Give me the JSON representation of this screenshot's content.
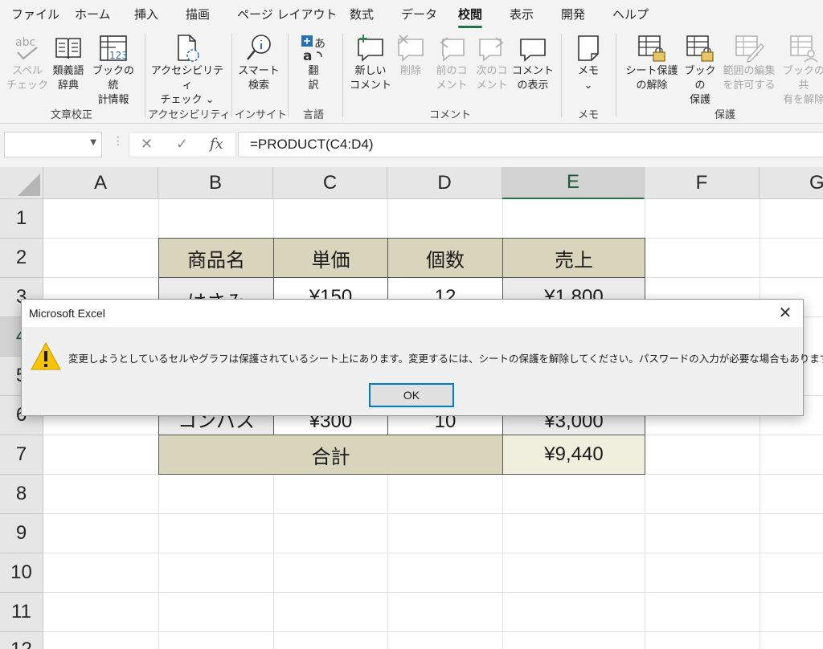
{
  "menu": {
    "tabs": [
      "ファイル",
      "ホーム",
      "挿入",
      "描画",
      "ページ レイアウト",
      "数式",
      "データ",
      "校閲",
      "表示",
      "開発",
      "ヘルプ"
    ],
    "active_tab": "校閲"
  },
  "ribbon": {
    "spell_check": "スペル\nチェック",
    "spell_icon_text": "abc",
    "thesaurus": "類義語\n辞典",
    "workbook_stats": "ブックの統\n計情報",
    "stats_icon_text": "123",
    "accessibility_check": "アクセシビリティ\nチェック ⌄",
    "smart_lookup": "スマート\n検索",
    "translate": "翻\n訳",
    "new_comment": "新しい\nコメント",
    "delete_comment": "削除",
    "prev_comment": "前のコ\nメント",
    "next_comment": "次のコ\nメント",
    "show_comments": "コメント\nの表示",
    "notes": "メモ\n⌄",
    "unprotect_sheet": "シート保護\nの解除",
    "protect_workbook": "ブックの\n保護",
    "allow_edit_ranges": "範囲の編集\nを許可する",
    "share_workbook": "ブックの共\n有を解除",
    "groups": {
      "proofing": "文章校正",
      "accessibility": "アクセシビリティ",
      "insights": "インサイト",
      "language": "言語",
      "comments": "コメント",
      "notes": "メモ",
      "protect": "保護"
    }
  },
  "formula_bar": {
    "name_box": "",
    "cancel_icon": "✕",
    "enter_icon": "✓",
    "fx_label": "fx",
    "formula": "=PRODUCT(C4:D4)"
  },
  "sheet": {
    "columns": [
      "A",
      "B",
      "C",
      "D",
      "E",
      "F",
      "G"
    ],
    "selected_column": "E",
    "rows": [
      "1",
      "2",
      "3",
      "4",
      "5",
      "6",
      "7",
      "8",
      "9",
      "10",
      "11",
      "12"
    ],
    "selected_row": "4",
    "table": {
      "headers": [
        "商品名",
        "単価",
        "個数",
        "売上"
      ],
      "row3": [
        "はさみ",
        "¥150",
        "12",
        "¥1,800"
      ],
      "row6": [
        "コンパス",
        "¥300",
        "10",
        "¥3,000"
      ],
      "total_label": "合計",
      "total_value": "¥9,440"
    }
  },
  "dialog": {
    "title": "Microsoft Excel",
    "close_icon": "✕",
    "message": "変更しようとしているセルやグラフは保護されているシート上にあります。変更するには、シートの保護を解除してください。パスワードの入力が必要な場合もあります。",
    "ok_label": "OK"
  },
  "colors": {
    "accent": "#217346",
    "table_header_fill": "#d9d4bc",
    "warning_yellow": "#f7c600",
    "ok_border": "#0078d7"
  }
}
